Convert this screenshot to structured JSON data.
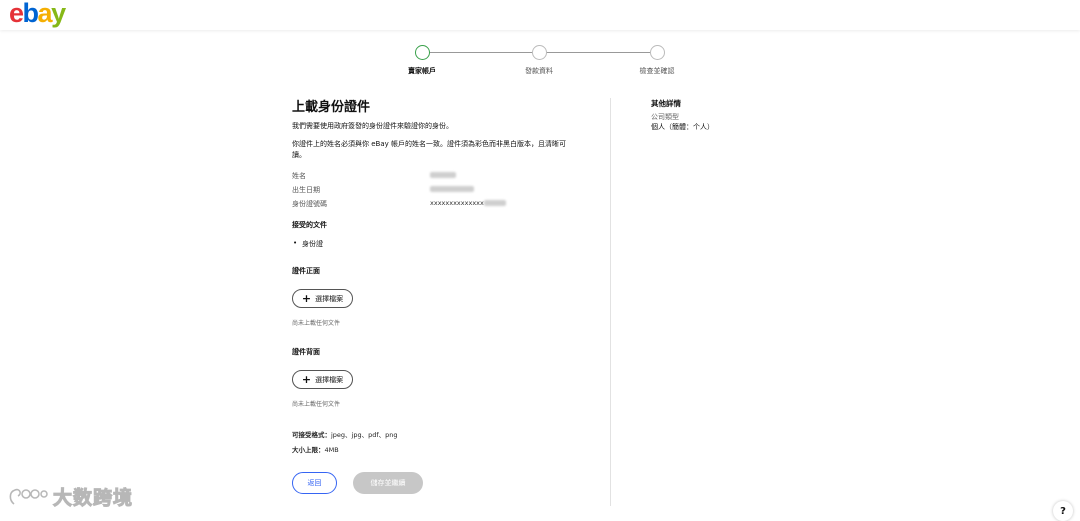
{
  "brand": {
    "letters": [
      "e",
      "b",
      "a",
      "y"
    ],
    "colors": [
      "#e53238",
      "#0064d2",
      "#f5af02",
      "#86b817"
    ]
  },
  "stepper": {
    "steps": [
      {
        "label": "賣家帳戶",
        "active": true
      },
      {
        "label": "發款資料",
        "active": false
      },
      {
        "label": "檢查並確認",
        "active": false
      }
    ]
  },
  "main": {
    "title": "上載身份證件",
    "intro": "我們需要使用政府簽發的身份證件來驗證你的身份。",
    "requirement": "你證件上的姓名必須與你 eBay 帳戶的姓名一致。證件須為彩色而非黑白版本，且清晰可讀。",
    "fields": [
      {
        "label": "姓名",
        "value": ""
      },
      {
        "label": "出生日期",
        "value": ""
      },
      {
        "label": "身份證號碼",
        "value": "xxxxxxxxxxxxxx"
      }
    ],
    "accepted_heading": "接受的文件",
    "accepted_items": [
      "身份證"
    ],
    "front": {
      "heading": "證件正面",
      "button": "選擇檔案",
      "note": "尚未上載任何文件"
    },
    "back": {
      "heading": "證件背面",
      "button": "選擇檔案",
      "note": "尚未上載任何文件"
    },
    "formats_label": "可接受格式：",
    "formats_value": "jpeg、jpg、pdf、png",
    "size_label": "大小上限：",
    "size_value": "4MB",
    "back_button": "返回",
    "save_button": "儲存並繼續"
  },
  "sidebar": {
    "title": "其他詳情",
    "company_type_label": "公司類型",
    "company_type_value": "個人（簡體：个人）"
  },
  "watermark": {
    "text": "大数跨境"
  },
  "help": {
    "label": "?"
  }
}
